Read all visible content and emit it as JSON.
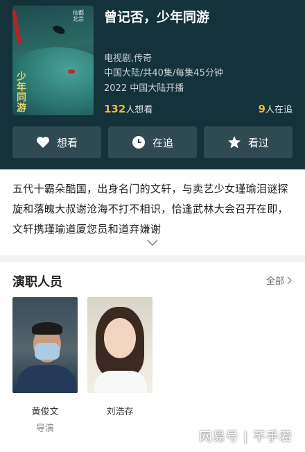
{
  "show": {
    "title": "曾记否，少年同游",
    "genre": "电视剧,传奇",
    "region_episodes": "中国大陆/共40集/每集45分钟",
    "premiere": "2022 中国大陆开播",
    "want_count": "132",
    "want_suffix": "人想看",
    "watching_count": "9",
    "watching_suffix": "人在追",
    "poster": {
      "vertical_title": "少年同游",
      "vertical_sub": "仙都 北宗",
      "colors": [
        "#1f4a4f",
        "#2c6a63",
        "#b3242a"
      ]
    }
  },
  "actions": [
    {
      "label": "想看",
      "icon": "heart-icon"
    },
    {
      "label": "在追",
      "icon": "clock-icon"
    },
    {
      "label": "看过",
      "icon": "star-icon"
    }
  ],
  "synopsis": "五代十霸朵酷国，出身名门的文轩，与卖艺少女瑾瑜泪谜探旋和落魄大叔谢沧海不打不相识，恰逢武林大会召开在即，文轩携瑾瑜道厦您员和道弃嫌谢",
  "cast": {
    "title": "演职人员",
    "all_label": "全部",
    "members": [
      {
        "name": "黄俊文",
        "role": "导演"
      },
      {
        "name": "刘浩存",
        "role": ""
      }
    ]
  },
  "watermark": "网易号 | 芊手若",
  "colors": {
    "header_bg": "#14323a",
    "button_bg": "#2f4a51",
    "accent_count": "#f0b43c"
  }
}
